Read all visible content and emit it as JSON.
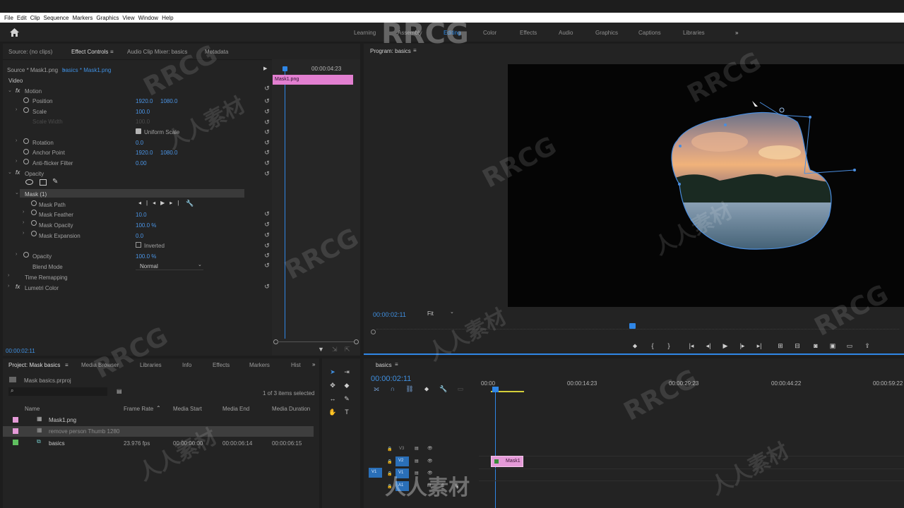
{
  "menu": [
    "File",
    "Edit",
    "Clip",
    "Sequence",
    "Markers",
    "Graphics",
    "View",
    "Window",
    "Help"
  ],
  "workspaces": [
    {
      "label": "Learning",
      "active": false
    },
    {
      "label": "Assembly",
      "active": false
    },
    {
      "label": "Editing",
      "active": true
    },
    {
      "label": "Color",
      "active": false
    },
    {
      "label": "Effects",
      "active": false
    },
    {
      "label": "Audio",
      "active": false
    },
    {
      "label": "Graphics",
      "active": false
    },
    {
      "label": "Captions",
      "active": false
    },
    {
      "label": "Libraries",
      "active": false
    }
  ],
  "source_tabs": {
    "source": "Source: (no clips)",
    "effect_controls": "Effect Controls",
    "audio_mixer": "Audio Clip Mixer: basics",
    "metadata": "Metadata"
  },
  "ec": {
    "source_label": "Source * Mask1.png",
    "clip_label": "basics * Mask1.png",
    "timecode_right": "00:00:04:23",
    "clip_bar": "Mask1.png",
    "video": "Video",
    "motion": "Motion",
    "position": "Position",
    "position_x": "1920.0",
    "position_y": "1080.0",
    "scale": "Scale",
    "scale_val": "100.0",
    "scale_width": "Scale Width",
    "scale_width_val": "100.0",
    "uniform_scale": "Uniform Scale",
    "rotation": "Rotation",
    "rotation_val": "0.0",
    "anchor": "Anchor Point",
    "anchor_x": "1920.0",
    "anchor_y": "1080.0",
    "antiflicker": "Anti-flicker Filter",
    "antiflicker_val": "0.00",
    "opacity_group": "Opacity",
    "mask": "Mask (1)",
    "mask_path": "Mask Path",
    "mask_feather": "Mask Feather",
    "mask_feather_val": "10.0",
    "mask_opacity": "Mask Opacity",
    "mask_opacity_val": "100.0 %",
    "mask_expansion": "Mask Expansion",
    "mask_expansion_val": "0.0",
    "inverted": "Inverted",
    "opacity": "Opacity",
    "opacity_val": "100.0 %",
    "blend_mode": "Blend Mode",
    "blend_mode_val": "Normal",
    "time_remap": "Time Remapping",
    "lumetri": "Lumetri Color",
    "current_tc": "00:00:02:11"
  },
  "program": {
    "title": "Program: basics",
    "timecode": "00:00:02:11",
    "fit": "Fit"
  },
  "project_tabs": {
    "project": "Project: Mask basics",
    "media_browser": "Media Browser",
    "libraries": "Libraries",
    "info": "Info",
    "effects": "Effects",
    "markers": "Markers",
    "history": "Hist"
  },
  "project": {
    "file": "Mask basics.prproj",
    "selected": "1 of 3 items selected",
    "columns": [
      "Name",
      "Frame Rate",
      "Media Start",
      "Media End",
      "Media Duration"
    ],
    "rows": [
      {
        "color": "#e59ad8",
        "name": "Mask1.png",
        "rate": "",
        "start": "",
        "end": "",
        "dur": ""
      },
      {
        "color": "#e59ad8",
        "name": "remove person Thumb 1280",
        "rate": "",
        "start": "",
        "end": "",
        "dur": ""
      },
      {
        "color": "#5fbf5f",
        "name": "basics",
        "rate": "23.976 fps",
        "start": "00:00:00:00",
        "end": "00:00:06:14",
        "dur": "00:00:06:15"
      }
    ]
  },
  "timeline": {
    "tab": "basics",
    "timecode": "00:00:02:11",
    "ruler": [
      "00:00",
      "00:00:14:23",
      "00:00:29:23",
      "00:00:44:22",
      "00:00:59:22"
    ],
    "tracks": [
      "V3",
      "V2",
      "V1",
      "A1"
    ],
    "clip": "Mask1",
    "v1_source": "V1"
  },
  "watermark_text": "RRCG",
  "watermark_cn": "人人素材"
}
